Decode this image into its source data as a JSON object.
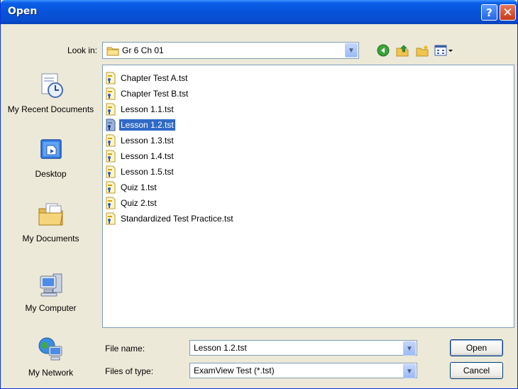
{
  "window": {
    "title": "Open",
    "help_label": "?",
    "close_label": "✕"
  },
  "lookin": {
    "label": "Look in:",
    "value": "Gr 6 Ch 01"
  },
  "toolbar": {
    "icons": [
      "back-icon",
      "up-folder-icon",
      "new-folder-icon",
      "views-menu-icon"
    ]
  },
  "places": [
    {
      "label": "My Recent Documents",
      "icon": "recent-documents-icon"
    },
    {
      "label": "Desktop",
      "icon": "desktop-icon"
    },
    {
      "label": "My Documents",
      "icon": "my-documents-icon"
    },
    {
      "label": "My Computer",
      "icon": "my-computer-icon"
    },
    {
      "label": "My Network",
      "icon": "my-network-icon"
    }
  ],
  "files": [
    "Chapter Test A.tst",
    "Chapter Test B.tst",
    "Lesson 1.1.tst",
    "Lesson 1.2.tst",
    "Lesson 1.3.tst",
    "Lesson 1.4.tst",
    "Lesson 1.5.tst",
    "Quiz 1.tst",
    "Quiz 2.tst",
    "Standardized Test Practice.tst"
  ],
  "selected_file": "Lesson 1.2.tst",
  "filename": {
    "label": "File name:",
    "value": "Lesson 1.2.tst"
  },
  "filetype": {
    "label": "Files of type:",
    "value": "ExamView Test (*.tst)"
  },
  "buttons": {
    "open": "Open",
    "cancel": "Cancel"
  },
  "colors": {
    "title_bar": "#0553D8",
    "selection": "#316AC5",
    "dialog_bg": "#ECE9D8"
  }
}
